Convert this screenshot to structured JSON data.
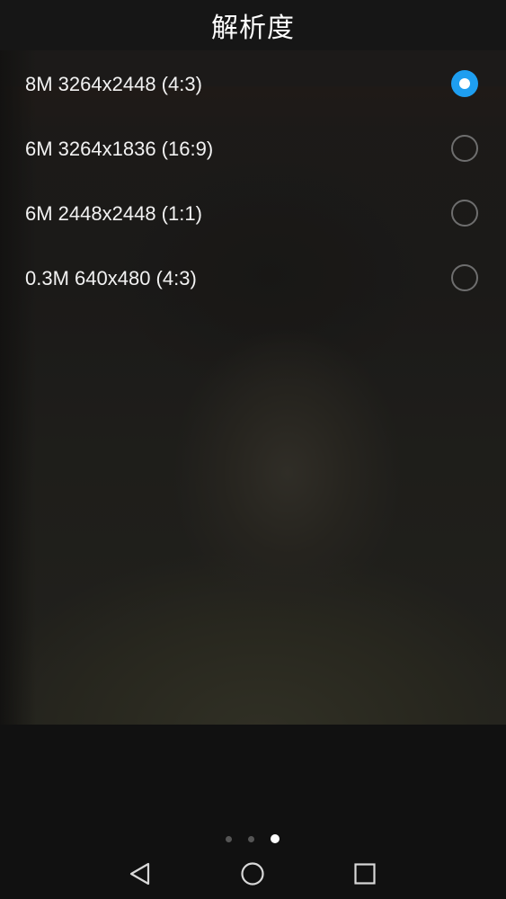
{
  "header": {
    "title": "解析度"
  },
  "resolution_options": [
    {
      "label": "8M 3264x2448 (4:3)",
      "selected": true
    },
    {
      "label": "6M 3264x1836 (16:9)",
      "selected": false
    },
    {
      "label": "6M 2448x2448 (1:1)",
      "selected": false
    },
    {
      "label": "0.3M 640x480 (4:3)",
      "selected": false
    }
  ],
  "page_indicator": {
    "total_pages": 3,
    "current_page": 3
  },
  "navigation_bar": {
    "buttons": [
      "back-icon",
      "home-icon",
      "recents-icon"
    ]
  },
  "colors": {
    "accent": "#1e9ef0",
    "title_bar": "#161616",
    "text": "#f2f2f2"
  }
}
